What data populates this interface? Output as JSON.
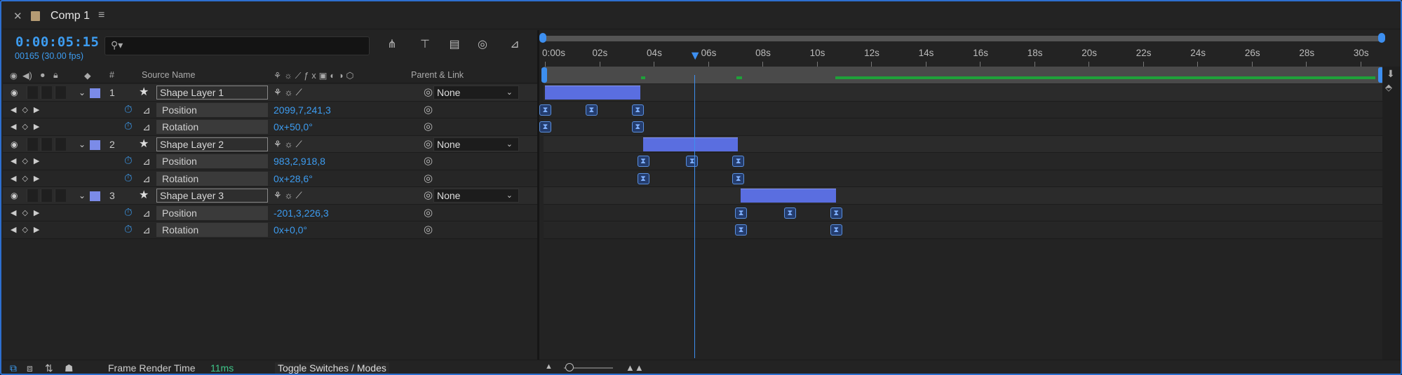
{
  "tab": {
    "title": "Comp 1",
    "close_icon": "close-icon",
    "menu_icon": "hamburger-icon"
  },
  "timecode": {
    "current": "0:00:05:15",
    "frames": "00165 (30.00 fps)"
  },
  "columns": {
    "number": "#",
    "source_name": "Source Name",
    "parent_link": "Parent & Link"
  },
  "layers": [
    {
      "number": "1",
      "name": "Shape Layer 1",
      "parent": "None",
      "props": [
        {
          "name": "Position",
          "value": "2099,7,241,3"
        },
        {
          "name": "Rotation",
          "value": "0x+50,0°"
        }
      ]
    },
    {
      "number": "2",
      "name": "Shape Layer 2",
      "parent": "None",
      "props": [
        {
          "name": "Position",
          "value": "983,2,918,8"
        },
        {
          "name": "Rotation",
          "value": "0x+28,6°"
        }
      ]
    },
    {
      "number": "3",
      "name": "Shape Layer 3",
      "parent": "None",
      "props": [
        {
          "name": "Position",
          "value": "-201,3,226,3"
        },
        {
          "name": "Rotation",
          "value": "0x+0,0°"
        }
      ]
    }
  ],
  "ruler": {
    "labels": [
      "0:00s",
      "02s",
      "04s",
      "06s",
      "08s",
      "10s",
      "12s",
      "14s",
      "16s",
      "18s",
      "20s",
      "22s",
      "24s",
      "26s",
      "28s",
      "30s"
    ],
    "start_seconds": 0,
    "end_seconds": 30.7
  },
  "playhead_seconds": 5.5,
  "layer_bars": [
    {
      "start": 0,
      "end": 3.5
    },
    {
      "start": 3.6,
      "end": 7.1
    },
    {
      "start": 7.2,
      "end": 10.7
    }
  ],
  "keyframes": [
    [],
    [
      0,
      1.7,
      3.4
    ],
    [
      0,
      3.4
    ],
    [],
    [
      3.6,
      5.4,
      7.1
    ],
    [
      3.6,
      7.1
    ],
    [],
    [
      7.2,
      9.0,
      10.7
    ],
    [
      7.2,
      10.7
    ]
  ],
  "bottom": {
    "render_label": "Frame Render Time",
    "render_value": "11ms",
    "toggle_label": "Toggle Switches / Modes"
  },
  "colors": {
    "accent": "#3d9cf0",
    "bar": "#5a6ee0",
    "label": "#7b8be8",
    "cache": "#1fa13a",
    "render_value": "#3fc78a"
  }
}
